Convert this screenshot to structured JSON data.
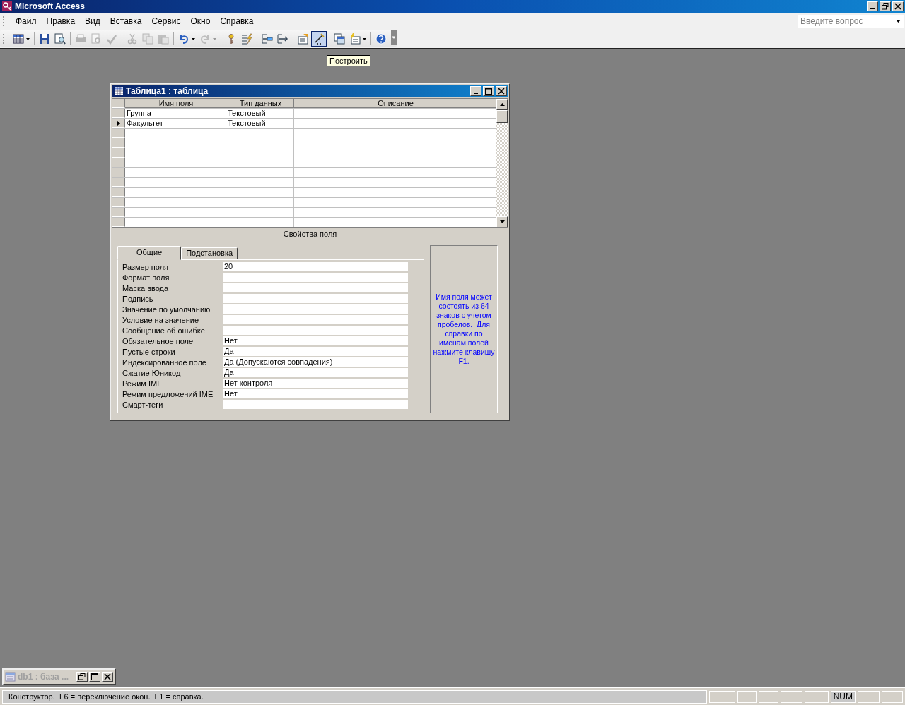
{
  "app": {
    "title": "Microsoft Access"
  },
  "menu": [
    "Файл",
    "Правка",
    "Вид",
    "Вставка",
    "Сервис",
    "Окно",
    "Справка"
  ],
  "help_search": {
    "placeholder": "Введите вопрос"
  },
  "toolbar": [
    {
      "kind": "datasheet",
      "dropdown": true,
      "disabled": false,
      "selected": false
    },
    {
      "kind": "separator"
    },
    {
      "kind": "save",
      "dropdown": false,
      "disabled": false,
      "selected": false
    },
    {
      "kind": "search",
      "dropdown": false,
      "disabled": false,
      "selected": false
    },
    {
      "kind": "separator"
    },
    {
      "kind": "print",
      "dropdown": false,
      "disabled": true,
      "selected": false
    },
    {
      "kind": "preview",
      "dropdown": false,
      "disabled": true,
      "selected": false
    },
    {
      "kind": "spelling",
      "dropdown": false,
      "disabled": true,
      "selected": false
    },
    {
      "kind": "separator"
    },
    {
      "kind": "cut",
      "dropdown": false,
      "disabled": true,
      "selected": false
    },
    {
      "kind": "copy",
      "dropdown": false,
      "disabled": true,
      "selected": false
    },
    {
      "kind": "paste",
      "dropdown": false,
      "disabled": true,
      "selected": false
    },
    {
      "kind": "separator"
    },
    {
      "kind": "undo",
      "dropdown": true,
      "disabled": false,
      "selected": false
    },
    {
      "kind": "redo",
      "dropdown": true,
      "disabled": true,
      "selected": false
    },
    {
      "kind": "separator"
    },
    {
      "kind": "key",
      "dropdown": false,
      "disabled": false,
      "selected": false
    },
    {
      "kind": "indexes",
      "dropdown": false,
      "disabled": false,
      "selected": false
    },
    {
      "kind": "separator"
    },
    {
      "kind": "insert_rows",
      "dropdown": false,
      "disabled": false,
      "selected": false
    },
    {
      "kind": "delete_rows",
      "dropdown": false,
      "disabled": false,
      "selected": false
    },
    {
      "kind": "separator"
    },
    {
      "kind": "properties",
      "dropdown": false,
      "disabled": false,
      "selected": false
    },
    {
      "kind": "build",
      "dropdown": false,
      "disabled": false,
      "selected": true
    },
    {
      "kind": "separator"
    },
    {
      "kind": "database_window",
      "dropdown": false,
      "disabled": false,
      "selected": false
    },
    {
      "kind": "new_object",
      "dropdown": true,
      "disabled": false,
      "selected": false
    },
    {
      "kind": "separator"
    },
    {
      "kind": "help",
      "dropdown": false,
      "disabled": false,
      "selected": false
    }
  ],
  "tooltip": "Построить",
  "table_window": {
    "title": "Таблица1 : таблица",
    "columns": [
      "Имя поля",
      "Тип данных",
      "Описание"
    ],
    "rows": [
      {
        "cells": [
          "Группа",
          "Текстовый"
        ],
        "current": false
      },
      {
        "cells": [
          "Факультет",
          "Текстовый"
        ],
        "current": true
      }
    ],
    "section_label": "Свойства поля",
    "tabs": [
      {
        "label": "Общие",
        "selected": true
      },
      {
        "label": "Подстановка",
        "selected": false
      }
    ],
    "properties": [
      {
        "label": "Размер поля",
        "value": "20"
      },
      {
        "label": "Формат поля"
      },
      {
        "label": "Маска ввода"
      },
      {
        "label": "Подпись"
      },
      {
        "label": "Значение по умолчанию"
      },
      {
        "label": "Условие на значение"
      },
      {
        "label": "Сообщение об ошибке"
      },
      {
        "label": "Обязательное поле",
        "value": "Нет"
      },
      {
        "label": "Пустые строки",
        "value": "Да"
      },
      {
        "label": "Индексированное поле",
        "value": "Да (Допускаются совпадения)"
      },
      {
        "label": "Сжатие Юникод",
        "value": "Да"
      },
      {
        "label": "Режим IME",
        "value": "Нет контроля"
      },
      {
        "label": "Режим предложений IME",
        "value": "Нет"
      },
      {
        "label": "Смарт-теги"
      }
    ],
    "help_text": "Имя поля может состоять из 64 знаков с учетом пробелов.  Для справки по именам полей нажмите клавишу F1."
  },
  "minimized_window": {
    "title": "db1 : база ..."
  },
  "status_bar": {
    "text": "Конструктор.  F6 = переключение окон.  F1 = справка.",
    "indicator": "NUM"
  }
}
